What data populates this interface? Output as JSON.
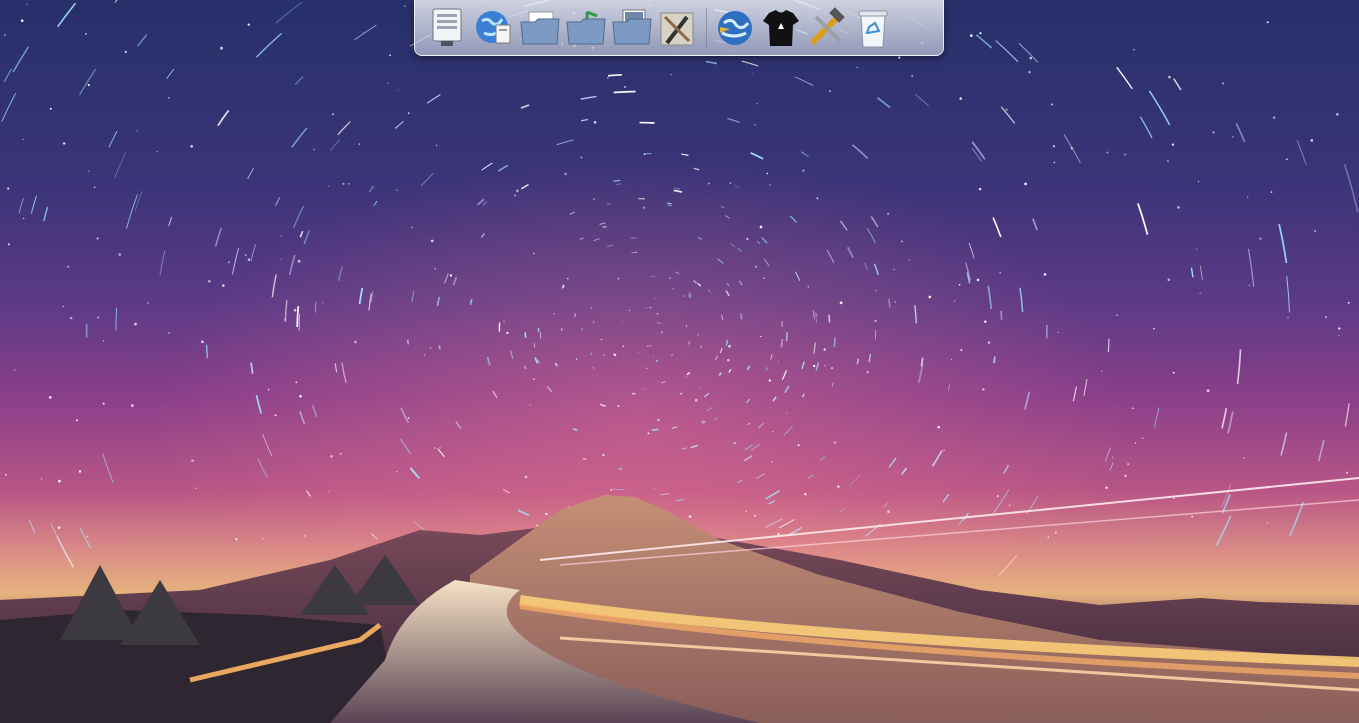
{
  "desktop": {
    "wallpaper": "star-trail-night-sky-mountain-road",
    "colors": {
      "sky_top": "#27306a",
      "sky_mid": "#8a3f8a",
      "horizon": "#e6b27e",
      "ground": "#3a2c3a"
    }
  },
  "dock": {
    "left_group": [
      {
        "id": "computer",
        "icon": "computer-icon"
      },
      {
        "id": "network",
        "icon": "network-globe-icon"
      },
      {
        "id": "documents",
        "icon": "documents-folder-icon"
      },
      {
        "id": "music",
        "icon": "music-folder-icon"
      },
      {
        "id": "pictures",
        "icon": "pictures-folder-icon"
      },
      {
        "id": "utilities",
        "icon": "utilities-tools-icon"
      }
    ],
    "right_group": [
      {
        "id": "browser",
        "icon": "web-browser-icon"
      },
      {
        "id": "appearance",
        "icon": "tshirt-icon"
      },
      {
        "id": "settings",
        "icon": "hammer-wrench-icon"
      },
      {
        "id": "trash",
        "icon": "recycle-bin-icon"
      }
    ]
  }
}
